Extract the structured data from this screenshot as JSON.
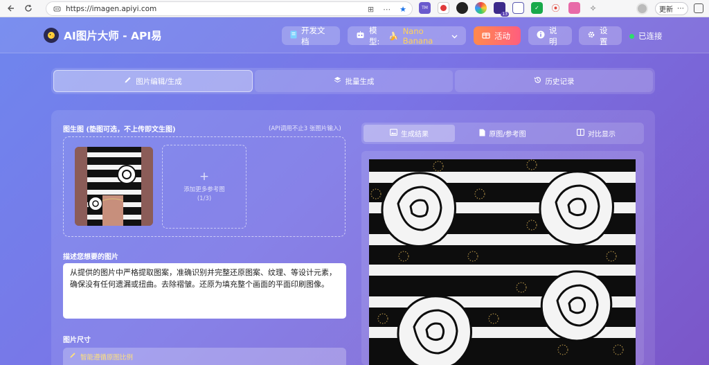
{
  "browser": {
    "url": "https://imagen.apiyi.com",
    "update_label": "更新",
    "extension_badge": "13"
  },
  "app": {
    "title": "AI图片大师 - API易",
    "topbar": {
      "docs_label": "开发文档",
      "model_prefix": "模型:",
      "model_name": "Nano Banana",
      "activity_label": "活动",
      "help_label": "说明",
      "settings_label": "设置",
      "status_label": "已连接"
    },
    "tabs": [
      {
        "label": "图片编辑/生成",
        "icon": "pencil-icon",
        "active": true
      },
      {
        "label": "批量生成",
        "icon": "layers-icon",
        "active": false
      },
      {
        "label": "历史记录",
        "icon": "history-icon",
        "active": false
      }
    ],
    "left": {
      "base_image_label": "图生图 (垫图可选，不上传即文生图)",
      "api_note": "(API调用不止3 张图片输入)",
      "add_ref_label": "添加更多参考图",
      "add_ref_count": "(1/3)",
      "prompt_label": "描述您想要的图片",
      "prompt_text": "从提供的图片中严格提取图案，准确识别并完整还原图案、纹理、等设计元素，确保没有任何遗漏或扭曲。去除褶皱。还原为填充整个画面的平面印刷图像。",
      "size_label": "图片尺寸",
      "smart_ratio_label": "智能遵循原图比例"
    },
    "right": {
      "tabs": [
        {
          "label": "生成结果",
          "icon": "image-icon",
          "active": true
        },
        {
          "label": "原图/参考图",
          "icon": "file-icon",
          "active": false
        },
        {
          "label": "对比显示",
          "icon": "compare-icon",
          "active": false
        }
      ]
    },
    "colors": {
      "accent_orange": "#ff7a5a",
      "model_yellow": "#ffd25a",
      "status_green": "#2ddc6b"
    }
  }
}
